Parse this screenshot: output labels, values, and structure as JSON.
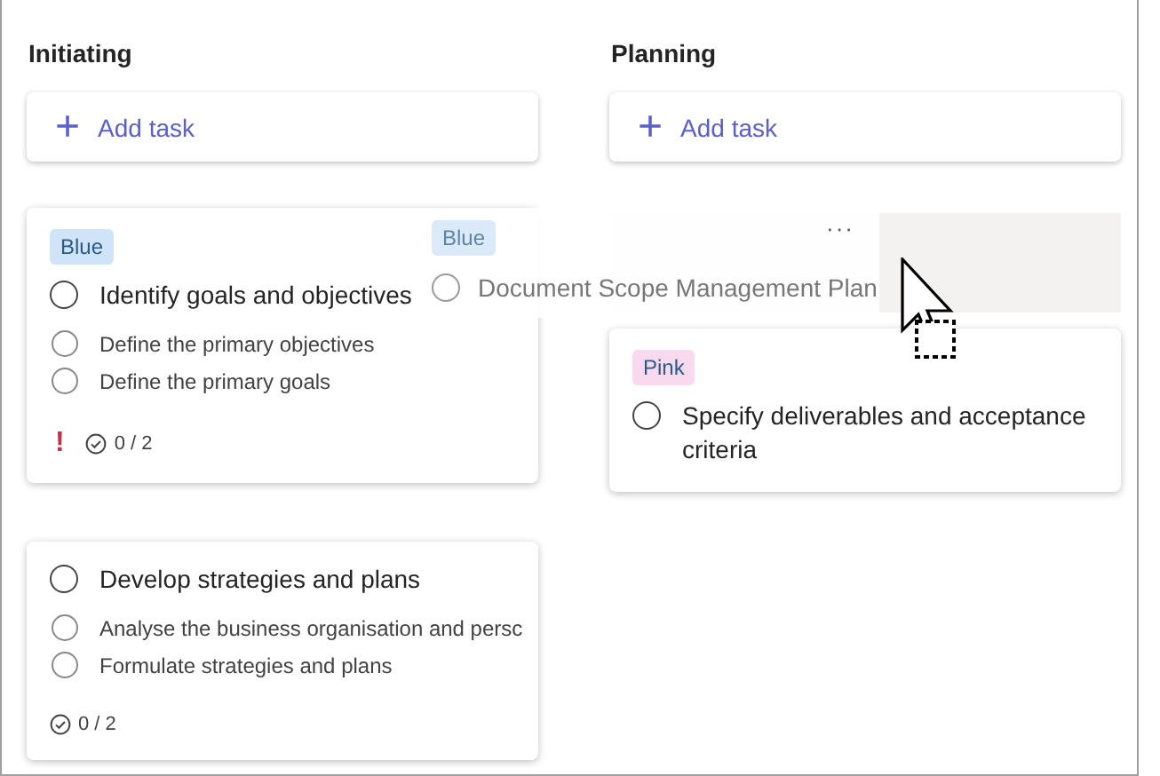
{
  "columns": [
    {
      "title": "Initiating",
      "add_task": {
        "icon": "+",
        "label": "Add task"
      },
      "cards": [
        {
          "label": {
            "text": "Blue",
            "color": "#cfe4f6"
          },
          "title": "Identify goals and objectives",
          "completed": false,
          "checklist": [
            {
              "text": "Define the primary objectives",
              "checked": false
            },
            {
              "text": "Define the primary goals",
              "checked": false
            }
          ],
          "priority": {
            "icon": "!",
            "kind": "important"
          },
          "progress": "0 / 2"
        },
        {
          "title": "Develop strategies and plans",
          "completed": false,
          "checklist": [
            {
              "text": "Analyse the business organisation and persc",
              "checked": false
            },
            {
              "text": "Formulate strategies and plans",
              "checked": false
            }
          ],
          "progress": "0 / 2"
        }
      ]
    },
    {
      "title": "Planning",
      "add_task": {
        "icon": "+",
        "label": "Add task"
      },
      "drop_placeholder": true,
      "cards": [
        {
          "label": {
            "text": "Pink",
            "color": "#f9d9ee"
          },
          "title": "Specify deliverables and acceptance criteria",
          "completed": false
        }
      ]
    }
  ],
  "dragged_card": {
    "label": {
      "text": "Blue",
      "color": "#cfe4f6"
    },
    "title": "Document Scope Management Plan",
    "completed": false,
    "more": "···"
  }
}
